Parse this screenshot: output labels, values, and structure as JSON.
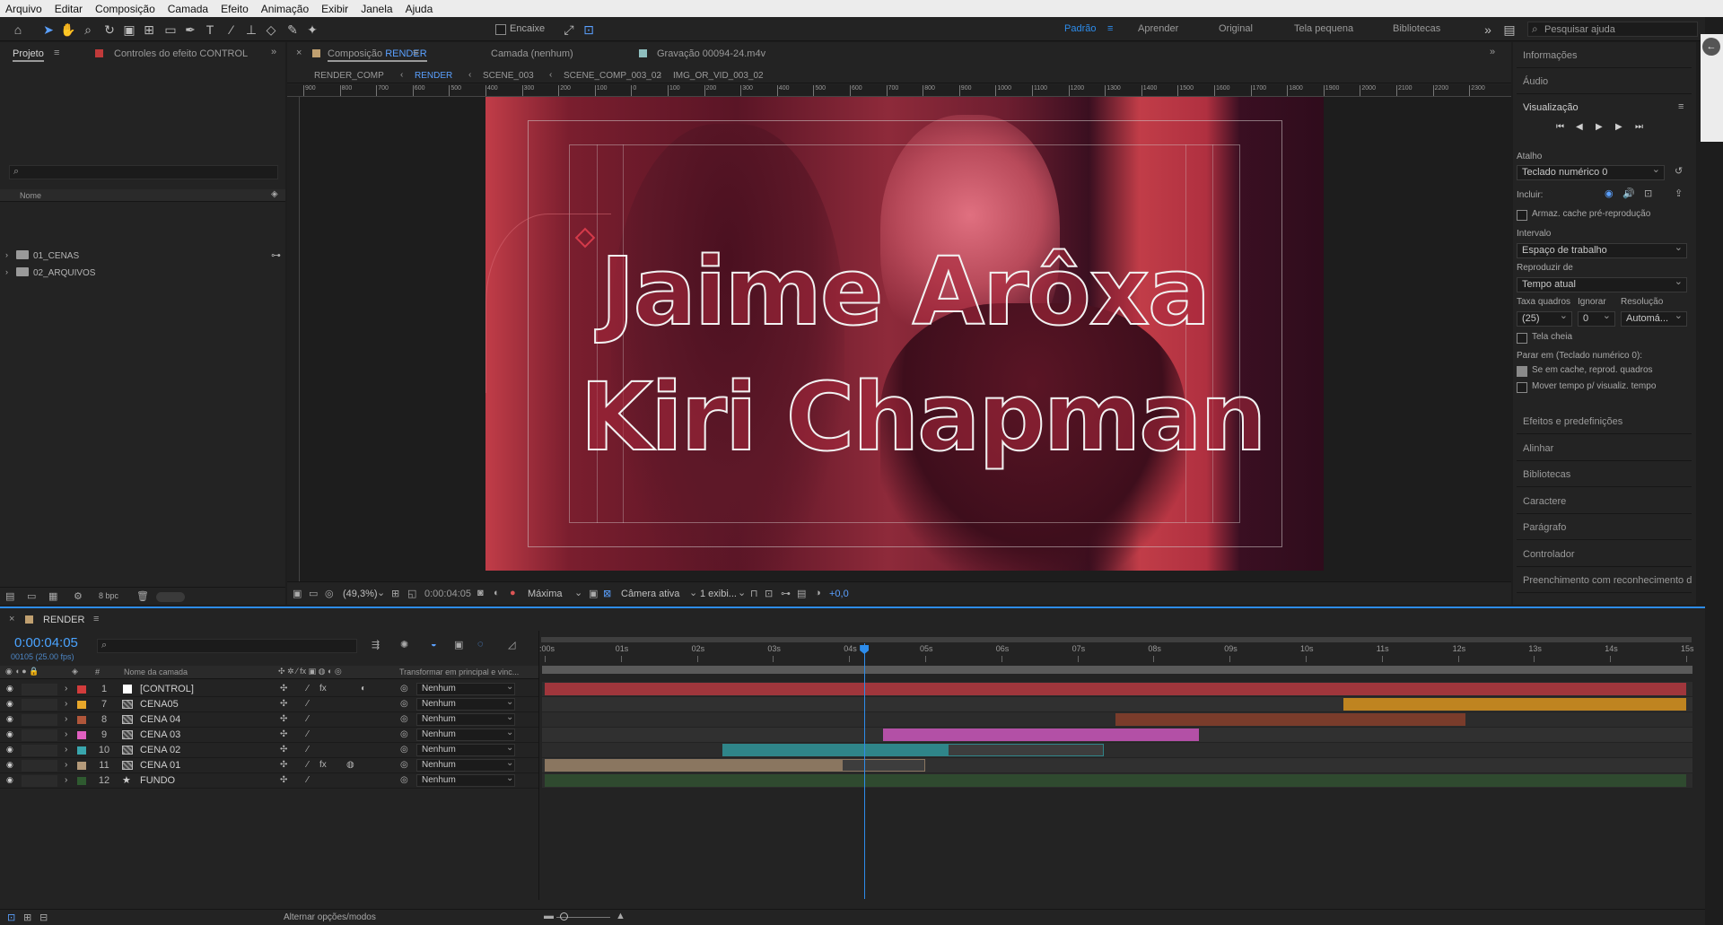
{
  "menu": [
    "Arquivo",
    "Editar",
    "Composição",
    "Camada",
    "Efeito",
    "Animação",
    "Exibir",
    "Janela",
    "Ajuda"
  ],
  "toolbar": {
    "snapping_label": "Encaixe",
    "workspaces": [
      "Padrão",
      "Aprender",
      "Original",
      "Tela pequena",
      "Bibliotecas"
    ],
    "active_workspace": "Padrão",
    "search_placeholder": "Pesquisar ajuda",
    "accent": "#2d8ceb"
  },
  "project_panel": {
    "tab": "Projeto",
    "effect_controls_tab": "Controles do efeito CONTROL",
    "column_name": "Nome",
    "items": [
      "01_CENAS",
      "02_ARQUIVOS"
    ],
    "bpc": "8 bpc"
  },
  "comp_panel": {
    "tab_prefix": "Composição",
    "tab_comp": "RENDER",
    "layer_tab": "Camada (nenhum)",
    "footage_tab": "Gravação 00094-24.m4v",
    "breadcrumbs": [
      "RENDER_COMP",
      "RENDER",
      "SCENE_003",
      "SCENE_COMP_003_02",
      "IMG_OR_VID_003_02"
    ],
    "active_breadcrumb": "RENDER",
    "ruler_labels": [
      "900",
      "800",
      "700",
      "600",
      "500",
      "400",
      "300",
      "200",
      "100",
      "0",
      "100",
      "200",
      "300",
      "400",
      "500",
      "600",
      "700",
      "800",
      "900",
      "1000",
      "1100",
      "1200",
      "1300",
      "1400",
      "1500",
      "1600",
      "1700",
      "1800",
      "1900",
      "2000",
      "2100",
      "2200",
      "2300"
    ],
    "title_line_1": "Jaime Arôxa",
    "title_line_2": "Kiri Chapman",
    "footer": {
      "zoom": "(49,3%)",
      "timecode": "0:00:04:05",
      "resolution": "Máxima",
      "camera": "Câmera ativa",
      "views": "1 exibi...",
      "exposure": "+0,0"
    },
    "tint_color": "#c93a4a"
  },
  "right_panel": {
    "sections_top": [
      "Informações",
      "Áudio"
    ],
    "preview": {
      "title": "Visualização",
      "shortcut_label": "Atalho",
      "shortcut_value": "Teclado numérico 0",
      "include_label": "Incluir:",
      "cache_label": "Armaz. cache pré-reprodução",
      "range_label": "Intervalo",
      "range_value": "Espaço de trabalho",
      "play_from_label": "Reproduzir de",
      "play_from_value": "Tempo atual",
      "frame_rate_label": "Taxa quadros",
      "skip_label": "Ignorar",
      "resolution_label": "Resolução",
      "frame_rate_value": "(25)",
      "skip_value": "0",
      "resolution_value": "Automá...",
      "fullscreen_label": "Tela cheia",
      "stop_label": "Parar em (Teclado numérico 0):",
      "opt1_label": "Se em cache, reprod. quadros",
      "opt2_label": "Mover tempo p/ visualiz. tempo"
    },
    "sections_bottom": [
      "Efeitos e predefinições",
      "Alinhar",
      "Bibliotecas",
      "Caractere",
      "Parágrafo",
      "Controlador",
      "Preenchimento com reconhecimento de conteúdo"
    ]
  },
  "timeline": {
    "tab": "RENDER",
    "timecode": "0:00:04:05",
    "frame_info": "00105 (25.00 fps)",
    "col_layer_name": "Nome da camada",
    "col_parent": "Transformar em principal e vinc...",
    "footer_label": "Alternar opções/modos",
    "time_labels": [
      ":00s",
      "01s",
      "02s",
      "03s",
      "04s",
      "05s",
      "06s",
      "07s",
      "08s",
      "09s",
      "10s",
      "11s",
      "12s",
      "13s",
      "14s",
      "15s"
    ],
    "playhead_seconds": 4.2,
    "duration_seconds": 15,
    "layers": [
      {
        "num": "1",
        "name": "[CONTROL]",
        "color": "#d23c3c",
        "swatch": "#ffffff",
        "parent": "Nenhum",
        "bar_start": 0,
        "bar_end": 15,
        "bar_color": "#a0363c",
        "work_start": 0,
        "work_end": 15
      },
      {
        "num": "7",
        "name": "CENA05",
        "color": "#e8a72a",
        "swatch": "img",
        "parent": "Nenhum",
        "bar_start": 10.5,
        "bar_end": 15,
        "bar_color": "#bf8420"
      },
      {
        "num": "8",
        "name": "CENA 04",
        "color": "#b0563a",
        "swatch": "img",
        "parent": "Nenhum",
        "bar_start": 7.5,
        "bar_end": 12.1,
        "bar_color": "#7a3c2b"
      },
      {
        "num": "9",
        "name": "CENA 03",
        "color": "#e060c0",
        "swatch": "img",
        "parent": "Nenhum",
        "bar_start": 4.45,
        "bar_end": 8.6,
        "bar_color": "#b350a6"
      },
      {
        "num": "10",
        "name": "CENA 02",
        "color": "#39a6ad",
        "swatch": "img",
        "parent": "Nenhum",
        "bar_start": 2.33,
        "bar_end": 7.35,
        "bar_color": "#2f8589",
        "bar_split": 5.3
      },
      {
        "num": "11",
        "name": "CENA 01",
        "color": "#b49a7a",
        "swatch": "img",
        "parent": "Nenhum",
        "bar_start": 0,
        "bar_end": 5.0,
        "bar_color": "#8a7660",
        "bar_split": 3.9
      },
      {
        "num": "12",
        "name": "FUNDO",
        "color": "#2f5a30",
        "swatch": "star",
        "parent": "Nenhum",
        "bar_start": 0,
        "bar_end": 15,
        "bar_color": "#2f4a2f"
      }
    ]
  }
}
